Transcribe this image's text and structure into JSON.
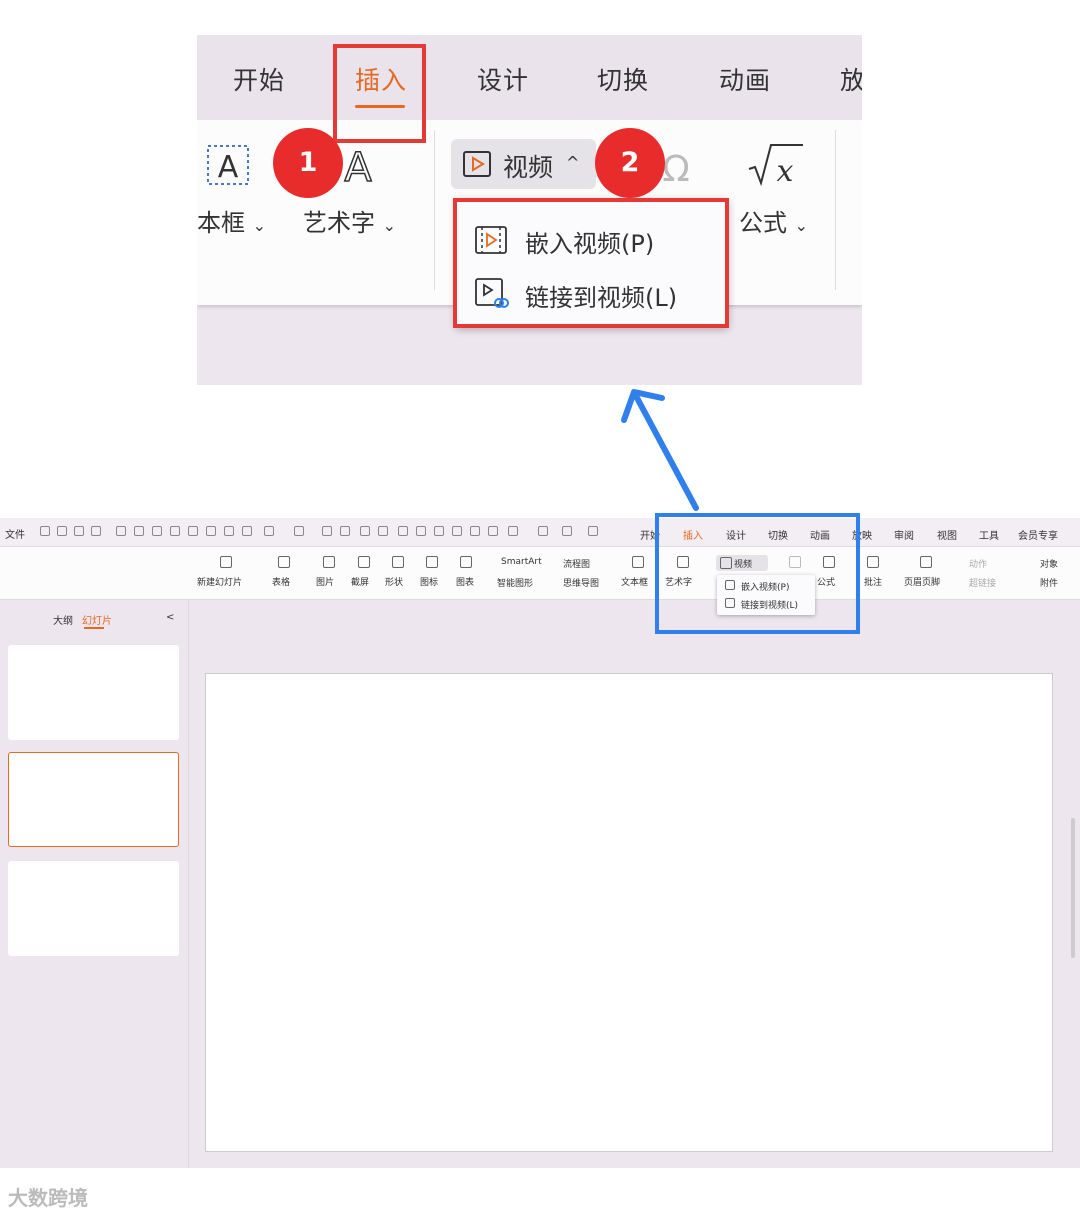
{
  "zoom": {
    "tabs": [
      "开始",
      "插入",
      "设计",
      "切换",
      "动画",
      "放"
    ],
    "active_tab": "插入",
    "textbox_label": "本框",
    "wordart_label": "艺术字",
    "video_label": "视频",
    "formula_label": "公式",
    "dropdown": [
      "嵌入视频(P)",
      "链接到视频(L)"
    ],
    "badges": [
      "1",
      "2"
    ],
    "caret": "⌄",
    "caret_up": "^"
  },
  "app": {
    "file_label": "文件",
    "tabs": [
      "开始",
      "插入",
      "设计",
      "切换",
      "动画",
      "放映",
      "审阅",
      "视图",
      "工具",
      "会员专享"
    ],
    "ribbon": {
      "new_slide": "新建幻灯片",
      "table": "表格",
      "picture": "图片",
      "screenshot": "截屏",
      "shape": "形状",
      "icon": "图标",
      "chart": "图表",
      "smartart": "SmartArt",
      "smart_shape": "智能图形",
      "flowchart": "流程图",
      "mindmap": "思维导图",
      "textbox": "文本框",
      "wordart": "艺术字",
      "video": "视频",
      "formula": "公式",
      "comment": "批注",
      "header_footer": "页眉页脚",
      "action": "动作",
      "hyperlink": "超链接",
      "object": "对象",
      "attachment": "附件"
    },
    "dropdown": [
      "嵌入视频(P)",
      "链接到视频(L)"
    ],
    "side_tabs": [
      "大纲",
      "幻灯片"
    ],
    "collapse": "<"
  },
  "watermark": "大数跨境",
  "colors": {
    "accent": "#e46a23",
    "highlight_red": "#e53935",
    "highlight_blue": "#2f80ed"
  }
}
